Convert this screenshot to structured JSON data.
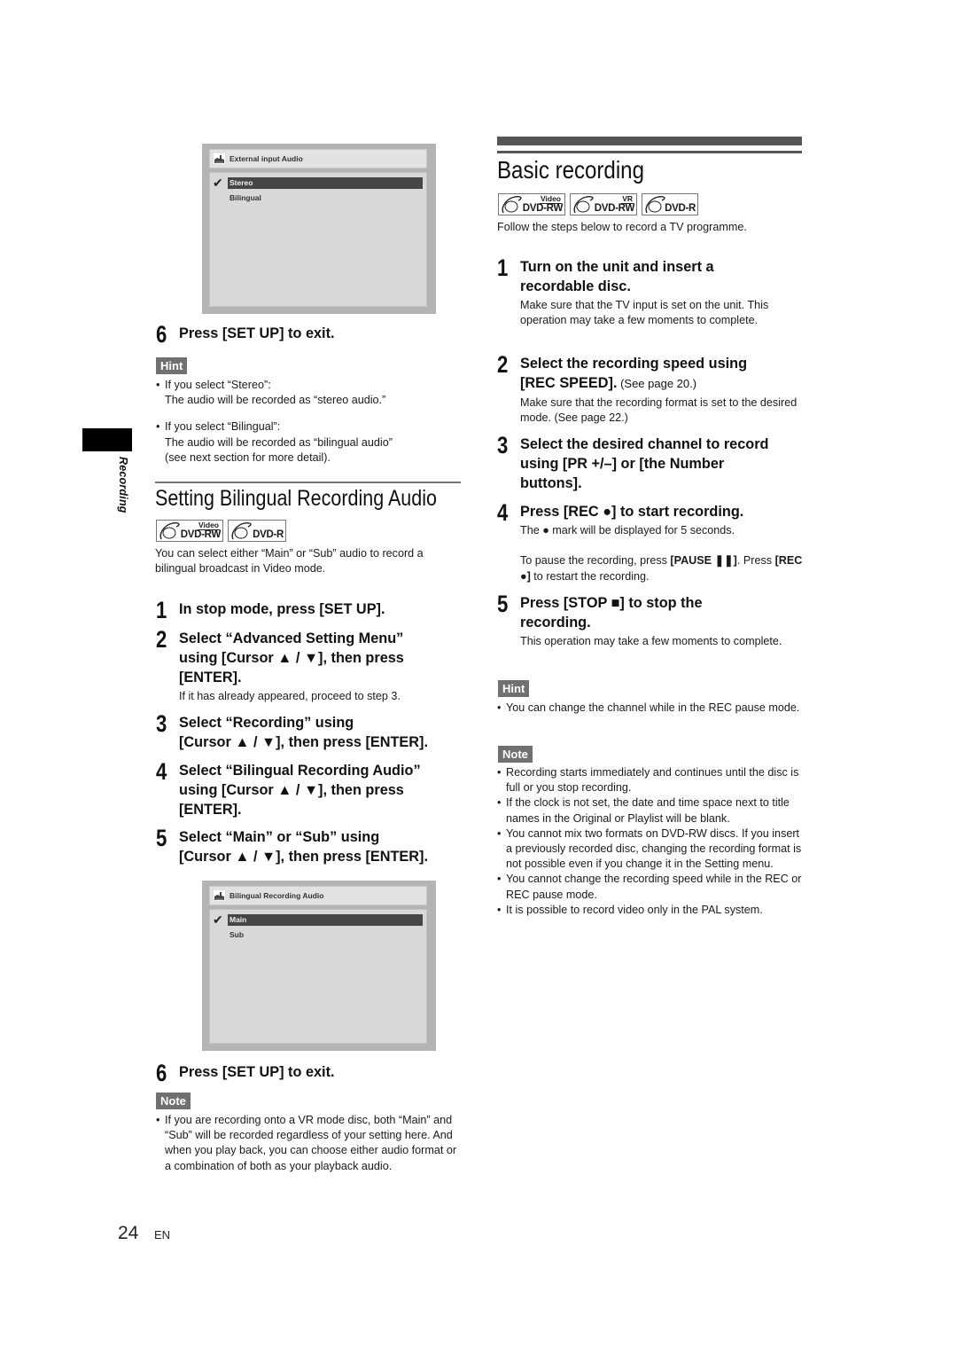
{
  "side_tab": {
    "label": "Recording"
  },
  "left": {
    "osd_top": {
      "title": "External input Audio",
      "icon": "setup-menu-icon",
      "items": [
        {
          "label": "Stereo",
          "selected": true,
          "checked": true
        },
        {
          "label": "Bilingual",
          "selected": false,
          "checked": false
        }
      ]
    },
    "step6_top": {
      "num": "6",
      "title": "Press [SET UP] to exit."
    },
    "hint": {
      "badge": "Hint",
      "items": [
        {
          "line1": "If you select “Stereo”:",
          "line2": "The audio will be recorded as “stereo audio.”"
        },
        {
          "line1": "If you select “Bilingual”:",
          "line2": "The audio will be recorded as “bilingual audio”",
          "line3": "(see next section for more detail)."
        }
      ]
    },
    "section": {
      "title": "Setting Bilingual Recording Audio",
      "logos": [
        {
          "top": "Video",
          "main": "DVD-RW"
        },
        {
          "top": "",
          "main": "DVD-R"
        }
      ],
      "intro": "You can select either “Main” or “Sub” audio to record a bilingual broadcast in Video mode."
    },
    "steps": [
      {
        "num": "1",
        "title": "In stop mode, press [SET UP]."
      },
      {
        "num": "2",
        "title_l1": "Select “Advanced Setting Menu”",
        "title_l2": "using [Cursor ▲ / ▼], then press",
        "title_l3": "[ENTER].",
        "desc": "If it has already appeared, proceed to step 3."
      },
      {
        "num": "3",
        "title_l1": "Select “Recording” using",
        "title_l2": "[Cursor ▲ / ▼], then press [ENTER]."
      },
      {
        "num": "4",
        "title_l1": "Select “Bilingual Recording Audio”",
        "title_l2": "using [Cursor ▲ / ▼], then press",
        "title_l3": "[ENTER]."
      },
      {
        "num": "5",
        "title_l1": "Select “Main” or “Sub” using",
        "title_l2": "[Cursor ▲ / ▼], then press [ENTER]."
      }
    ],
    "osd_bottom": {
      "title": "Bilingual Recording Audio",
      "icon": "setup-menu-icon",
      "items": [
        {
          "label": "Main",
          "selected": true,
          "checked": true
        },
        {
          "label": "Sub",
          "selected": false,
          "checked": false
        }
      ]
    },
    "step6_bottom": {
      "num": "6",
      "title": "Press [SET UP] to exit."
    },
    "note": {
      "badge": "Note",
      "items": [
        "If you are recording onto a VR mode disc, both “Main” and “Sub” will be recorded regardless of your setting here. And when you play back, you can choose either audio format or a combination of both as your playback audio."
      ]
    }
  },
  "right": {
    "title": "Basic recording",
    "logos": [
      {
        "top": "Video",
        "main": "DVD-RW"
      },
      {
        "top": "VR",
        "main": "DVD-RW"
      },
      {
        "top": "",
        "main": "DVD-R"
      }
    ],
    "intro": "Follow the steps below to record a TV programme.",
    "steps": [
      {
        "num": "1",
        "title_l1": "Turn on the unit and insert a",
        "title_l2": "recordable disc.",
        "desc": "Make sure that the TV input is set on the unit. This operation may take a few moments to complete."
      },
      {
        "num": "2",
        "title_l1": "Select the recording speed using",
        "title_l2": "[REC SPEED].",
        "ref": " (See page 20.)",
        "desc": "Make sure that the recording format is set to the desired mode. (See page 22.)"
      },
      {
        "num": "3",
        "title_l1": "Select the desired channel to record",
        "title_l2": "using [PR +/–] or [the Number",
        "title_l3": "buttons]."
      },
      {
        "num": "4",
        "title": "Press [REC ●] to start recording.",
        "desc": "The ● mark will be displayed for 5 seconds.",
        "desc2_a": "To pause the recording, press ",
        "desc2_b": "[PAUSE ❚❚]",
        "desc2_c": ". Press ",
        "desc2_d": "[REC ●]",
        "desc2_e": " to restart the recording."
      },
      {
        "num": "5",
        "title_l1": "Press [STOP ■] to stop the",
        "title_l2": "recording.",
        "desc": "This operation may take a few moments to complete."
      }
    ],
    "hint": {
      "badge": "Hint",
      "items": [
        "You can change the channel while in the REC pause mode."
      ]
    },
    "note": {
      "badge": "Note",
      "items": [
        "Recording starts immediately and continues until the disc is full or you stop recording.",
        "If the clock is not set, the date and time space next to title names in the Original or Playlist will be blank.",
        "You cannot mix two formats on DVD-RW discs. If you insert a previously recorded disc, changing the recording format is not possible even if you change it in the Setting menu.",
        "You cannot change the recording speed while in the REC or REC pause mode.",
        "It is possible to record video only in the PAL system."
      ]
    }
  },
  "footer": {
    "page": "24",
    "lang": "EN"
  }
}
